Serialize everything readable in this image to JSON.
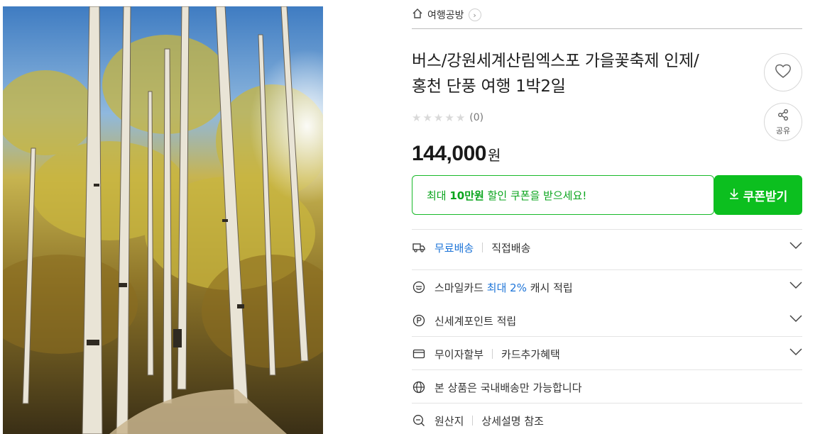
{
  "breadcrumb": {
    "label": "여행공방",
    "home_icon": "home-icon",
    "arrow_icon": "chevron-right-icon"
  },
  "product": {
    "title_line1": "버스/강원세계산림엑스포 가을꽃축제 인제/",
    "title_line2": "홍천 단풍 여행 1박2일",
    "rating_count": "(0)",
    "rating_stars": 0,
    "price": "144,000",
    "price_unit": "원"
  },
  "actions": {
    "like_icon": "heart-icon",
    "share_label": "공유",
    "share_icon": "share-icon"
  },
  "coupon": {
    "prefix": "최대 ",
    "amount": "10만원",
    "suffix": " 할인 쿠폰을 받으세요!",
    "button_label": "쿠폰받기",
    "button_icon": "download-icon",
    "accent": "#0cbf1f"
  },
  "info_rows": {
    "shipping": {
      "label": "무료배송",
      "extra": "직접배송",
      "icon": "truck-icon"
    },
    "smilecard": {
      "prefix": "스마일카드 ",
      "highlight": "최대 2%",
      "suffix": " 캐시 적립",
      "icon": "smile-card-icon"
    },
    "point": {
      "label": "신세계포인트 적립",
      "icon": "point-icon"
    },
    "installment": {
      "label": "무이자할부",
      "extra": "카드추가혜택",
      "icon": "card-icon"
    },
    "domestic": {
      "label": "본 상품은 국내배송만 가능합니다",
      "icon": "globe-icon"
    },
    "origin": {
      "label": "원산지",
      "extra": "상세설명 참조",
      "icon": "search-icon"
    }
  }
}
